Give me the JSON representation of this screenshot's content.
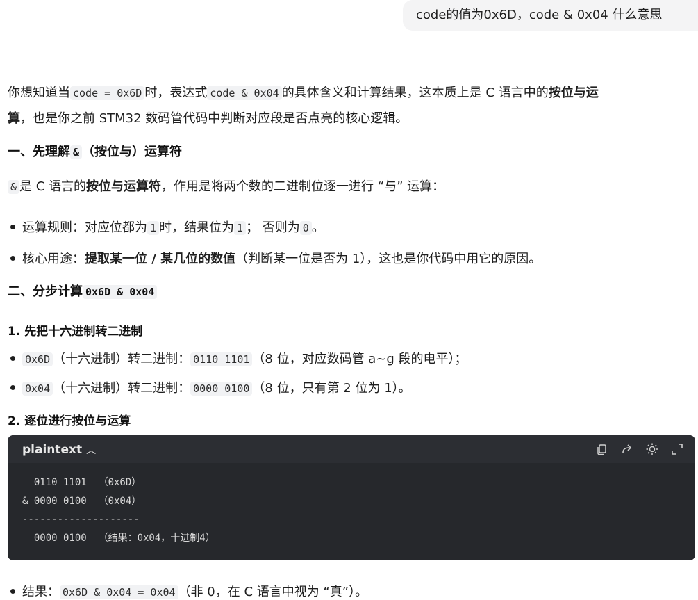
{
  "user_message": "code的值为0x6D，code & 0x04 什么意思",
  "intro": {
    "t1": "你想知道当",
    "c1": "code = 0x6D",
    "t2": "时，表达式",
    "c2": "code & 0x04",
    "t3": "的具体含义和计算结果，这本质上是 C 语言中的",
    "b1": "按位与运",
    "b2": "算",
    "t4": "，也是你之前 STM32 数码管代码中判断对应段是否点亮的核心逻辑。"
  },
  "section1": {
    "pre": "一、先理解",
    "code": "&",
    "post": "（按位与）运算符"
  },
  "para2": {
    "code": "&",
    "t1": "是 C 语言的",
    "b1": "按位与运算符",
    "t2": "，作用是将两个数的二进制位逐一进行 “与” 运算："
  },
  "bullets1": [
    {
      "t1": "运算规则：对应位都为",
      "c1": "1",
      "t2": "时，结果位为",
      "c2": "1",
      "t3": "； 否则为",
      "c3": "0",
      "t4": "。"
    },
    {
      "t1": "核心用途：",
      "b": "提取某一位 / 某几位的数值",
      "t2": "（判断某一位是否为 1），这也是你代码中用它的原因。"
    }
  ],
  "section2": {
    "pre": "二、分步计算",
    "code": "0x6D & 0x04"
  },
  "sub1": "1. 先把十六进制转二进制",
  "bullets2": [
    {
      "c1": "0x6D",
      "t1": "（十六进制）转二进制：",
      "c2": "0110 1101",
      "t2": "（8 位，对应数码管 a~g 段的电平）；"
    },
    {
      "c1": "0x04",
      "t1": "（十六进制）转二进制：",
      "c2": "0000 0100",
      "t2": "（8 位，只有第 2 位为 1）。"
    }
  ],
  "sub2": "2. 逐位进行按位与运算",
  "codeblock": {
    "lang": "plaintext",
    "lines": [
      "  0110 1101  （0x6D）",
      "& 0000 0100  （0x04）",
      "--------------------",
      "  0000 0100  （结果：0x04，十进制4）"
    ],
    "icons": [
      "copy-icon",
      "share-icon",
      "theme-icon",
      "expand-icon"
    ]
  },
  "result": {
    "t1": "结果：",
    "c1": "0x6D & 0x04 = 0x04",
    "t2": "（非 0，在 C 语言中视为 “真”）。"
  }
}
